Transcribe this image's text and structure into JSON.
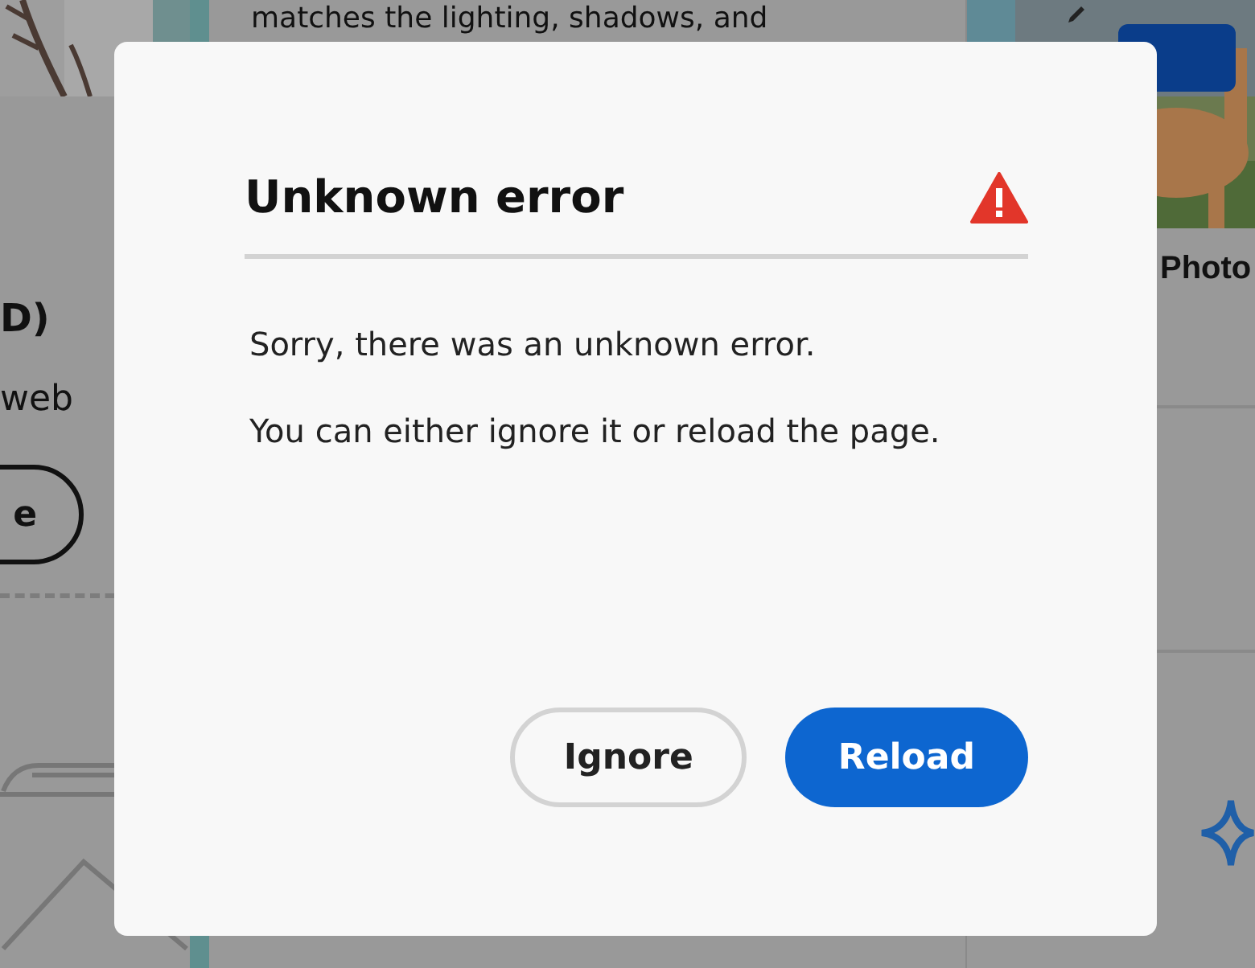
{
  "background": {
    "left_card": {
      "title_fragment": "D)",
      "text_fragment": "web",
      "button_fragment": "e"
    },
    "middle_card": {
      "text_fragment": "matches the lighting, shadows, and"
    },
    "right_card": {
      "title_fragment": "Photo"
    }
  },
  "dialog": {
    "title": "Unknown error",
    "message": "Sorry, there was an unknown error.",
    "detail": "You can either ignore it or reload the page.",
    "buttons": [
      {
        "label": "Ignore",
        "kind": "secondary"
      },
      {
        "label": "Reload",
        "kind": "primary"
      }
    ]
  }
}
